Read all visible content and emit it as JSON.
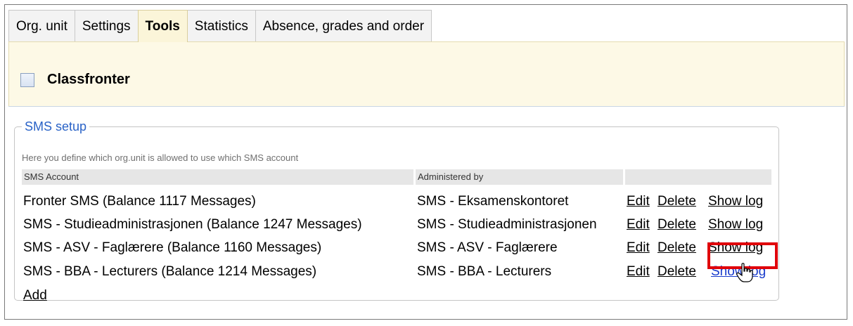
{
  "tabs": [
    {
      "label": "Org. unit",
      "active": false
    },
    {
      "label": "Settings",
      "active": false
    },
    {
      "label": "Tools",
      "active": true
    },
    {
      "label": "Statistics",
      "active": false
    },
    {
      "label": "Absence, grades and order",
      "active": false
    }
  ],
  "classfronter": {
    "label": "Classfronter",
    "checked": false
  },
  "sms_setup": {
    "legend": "SMS setup",
    "description": "Here you define which org.unit is allowed to use which SMS account",
    "columns": {
      "account": "SMS Account",
      "admin": "Administered by"
    },
    "rows": [
      {
        "account": "Fronter SMS (Balance 1117 Messages)",
        "admin": "SMS - Eksamenskontoret",
        "edit": "Edit",
        "delete": "Delete",
        "log": "Show log"
      },
      {
        "account": "SMS - Studieadministrasjonen (Balance 1247 Messages)",
        "admin": "SMS - Studieadministrasjonen",
        "edit": "Edit",
        "delete": "Delete",
        "log": "Show log"
      },
      {
        "account": "SMS - ASV - Faglærere (Balance 1160 Messages)",
        "admin": "SMS - ASV - Faglærere",
        "edit": "Edit",
        "delete": "Delete",
        "log": "Show log"
      },
      {
        "account": "SMS - BBA - Lecturers (Balance 1214 Messages)",
        "admin": "SMS - BBA - Lecturers",
        "edit": "Edit",
        "delete": "Delete",
        "log": "Show log"
      }
    ],
    "add_label": "Add"
  },
  "colors": {
    "highlight": "#e0000a",
    "legend": "#2a63c7",
    "active_tab": "#fbf5d9",
    "panel": "#fdf9e6"
  },
  "cursor_icon": "hand-pointer-icon"
}
